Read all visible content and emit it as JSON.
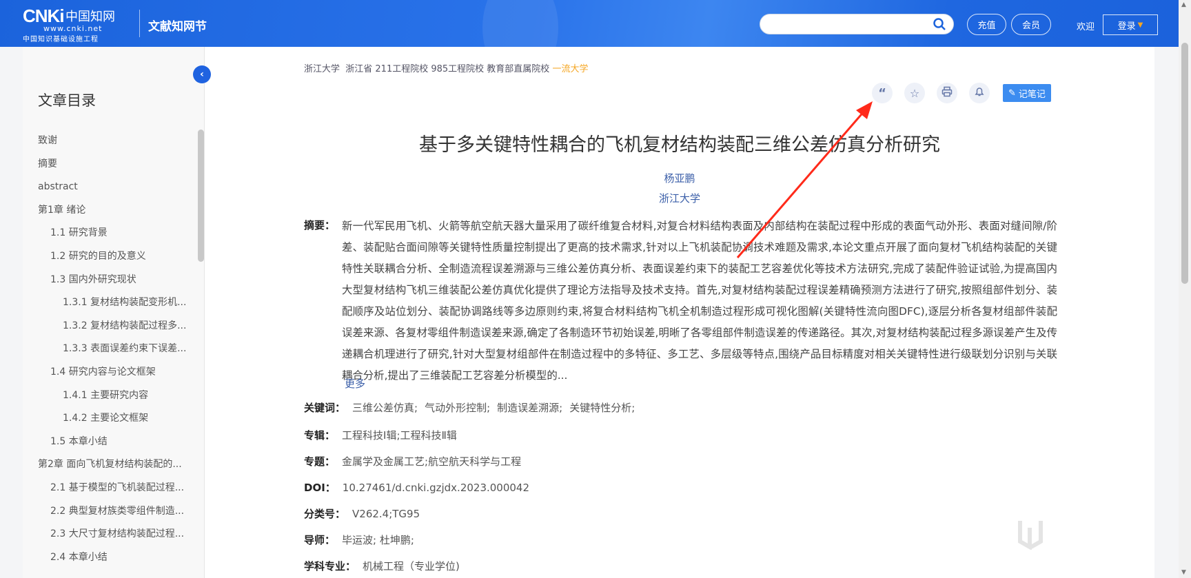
{
  "header": {
    "logo_text": "CNKi中国知网",
    "logo_url": "www.cnki.net",
    "logo_sub": "中国知识基础设施工程",
    "site_name": "文献知网节",
    "search_placeholder": "",
    "recharge": "充值",
    "member": "会员",
    "welcome": "欢迎",
    "login": "登录",
    "brand_color": "#1b63dc"
  },
  "sidebar": {
    "title": "文章目录",
    "items": [
      {
        "label": "致谢",
        "level": 1
      },
      {
        "label": "摘要",
        "level": 1
      },
      {
        "label": "abstract",
        "level": 1
      },
      {
        "label": "第1章 绪论",
        "level": 1
      },
      {
        "label": "1.1 研究背景",
        "level": 2
      },
      {
        "label": "1.2 研究的目的及意义",
        "level": 2
      },
      {
        "label": "1.3 国内外研究现状",
        "level": 2
      },
      {
        "label": "1.3.1 复材结构装配变形机...",
        "level": 3
      },
      {
        "label": "1.3.2 复材结构装配过程多...",
        "level": 3
      },
      {
        "label": "1.3.3 表面误差约束下误差...",
        "level": 3
      },
      {
        "label": "1.4 研究内容与论文框架",
        "level": 2
      },
      {
        "label": "1.4.1 主要研究内容",
        "level": 3
      },
      {
        "label": "1.4.2 主要论文框架",
        "level": 3
      },
      {
        "label": "1.5 本章小结",
        "level": 2
      },
      {
        "label": "第2章 面向飞机复材结构装配的...",
        "level": 1
      },
      {
        "label": "2.1 基于模型的飞机装配过程...",
        "level": 2
      },
      {
        "label": "2.2 典型复材族类零组件制造...",
        "level": 2
      },
      {
        "label": "2.3 大尺寸复材结构装配过程...",
        "level": 2
      },
      {
        "label": "2.4 本章小结",
        "level": 2
      }
    ]
  },
  "main": {
    "institution": "浙江大学",
    "institution_tags": "浙江省 211工程院校 985工程院校 教育部直属院校",
    "institution_highlight": "一流大学",
    "tools": {
      "cite": "cite-icon",
      "favorite": "star-icon",
      "print": "print-icon",
      "alert": "bell-icon",
      "note": "记笔记"
    },
    "title": "基于多关键特性耦合的飞机复材结构装配三维公差仿真分析研究",
    "author": "杨亚鹏",
    "organization": "浙江大学",
    "abstract_label": "摘要：",
    "abstract": "新一代军民用飞机、火箭等航空航天器大量采用了碳纤维复合材料,对复合材料结构表面及内部结构在装配过程中形成的表面气动外形、表面对缝间隙/阶差、装配贴合面间隙等关键特性质量控制提出了更高的技术需求,针对以上飞机装配协调技术难题及需求,本论文重点开展了面向复材飞机结构装配的关键特性关联耦合分析、全制造流程误差溯源与三维公差仿真分析、表面误差约束下的装配工艺容差优化等技术方法研究,完成了装配件验证试验,为提高国内大型复材结构飞机三维装配公差仿真优化提供了理论方法指导及技术支持。首先,对复材结构装配过程误差精确预测方法进行了研究,按照组部件划分、装配顺序及站位划分、装配协调路线等多边原则约束,将复合材料结构飞机全机制造过程形成可视化图解(关键特性流向图DFC),逐层分析各复材组部件装配误差来源、各复材零组件制造误差来源,确定了各制造环节初始误差,明晰了各零组部件制造误差的传递路径。其次,对复材结构装配过程多源误差产生及传递耦合机理进行了研究,针对大型复材组部件在制造过程中的多特征、多工艺、多层级等特点,围绕产品目标精度对相关关键特性进行级联划分识别与关联耦合分析,提出了三维装配工艺容差分析模型的...",
    "more": "更多",
    "keywords_label": "关键词：",
    "keywords": [
      "三维公差仿真;",
      "气动外形控制;",
      "制造误差溯源;",
      "关键特性分析;"
    ],
    "meta": [
      {
        "label": "专辑：",
        "value": "工程科技Ⅰ辑;工程科技Ⅱ辑"
      },
      {
        "label": "专题：",
        "value": "金属学及金属工艺;航空航天科学与工程"
      },
      {
        "label": "DOI：",
        "value": "10.27461/d.cnki.gzjdx.2023.000042"
      },
      {
        "label": "分类号：",
        "value": "V262.4;TG95"
      },
      {
        "label": "导师：",
        "value": "毕运波; 杜坤鹏;"
      },
      {
        "label": "学科专业：",
        "value": "机械工程（专业学位)"
      }
    ]
  },
  "watermark": "小黑盒",
  "annotation_color": "#ff2a1a"
}
